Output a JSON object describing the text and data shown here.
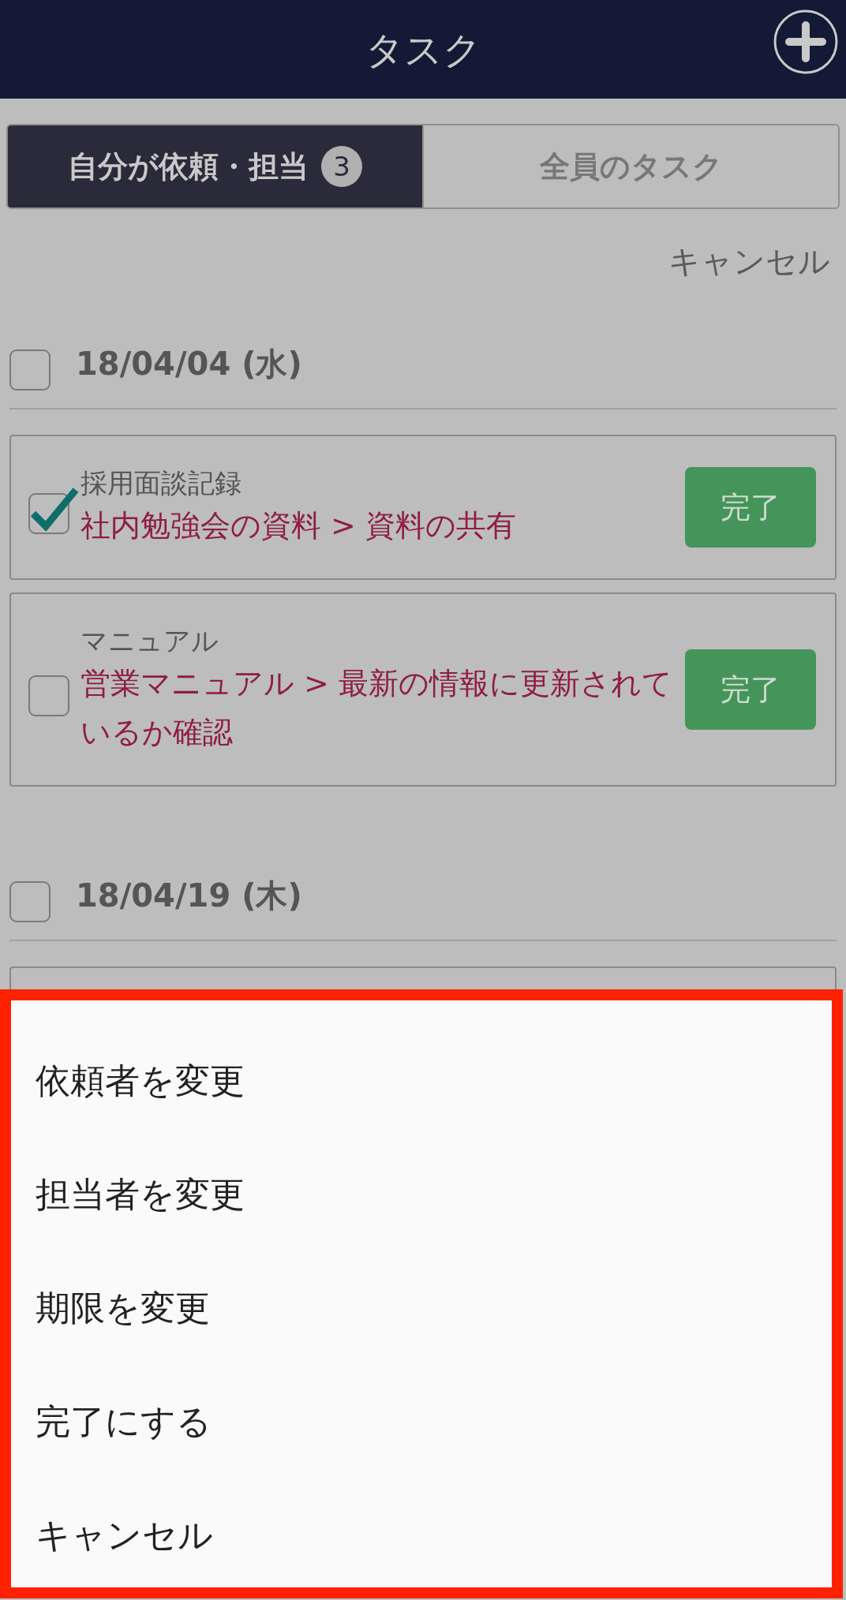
{
  "header": {
    "title": "タスク"
  },
  "tabs": [
    {
      "label": "自分が依頼・担当",
      "badge": "3",
      "selected": true
    },
    {
      "label": "全員のタスク",
      "selected": false
    }
  ],
  "cancel_link": "キャンセル",
  "groups": [
    {
      "date": "18/04/04 (水)",
      "checked": false,
      "tasks": [
        {
          "category": "採用面談記録",
          "title": "社内勉強会の資料 > 資料の共有",
          "checked": true,
          "button": "完了"
        },
        {
          "category": "マニュアル",
          "title": "営業マニュアル > 最新の情報に更新されているか確認",
          "checked": false,
          "button": "完了"
        }
      ]
    },
    {
      "date": "18/04/19 (木)",
      "checked": false
    }
  ],
  "action_sheet": {
    "items": [
      "依頼者を変更",
      "担当者を変更",
      "期限を変更",
      "完了にする",
      "キャンセル"
    ]
  }
}
